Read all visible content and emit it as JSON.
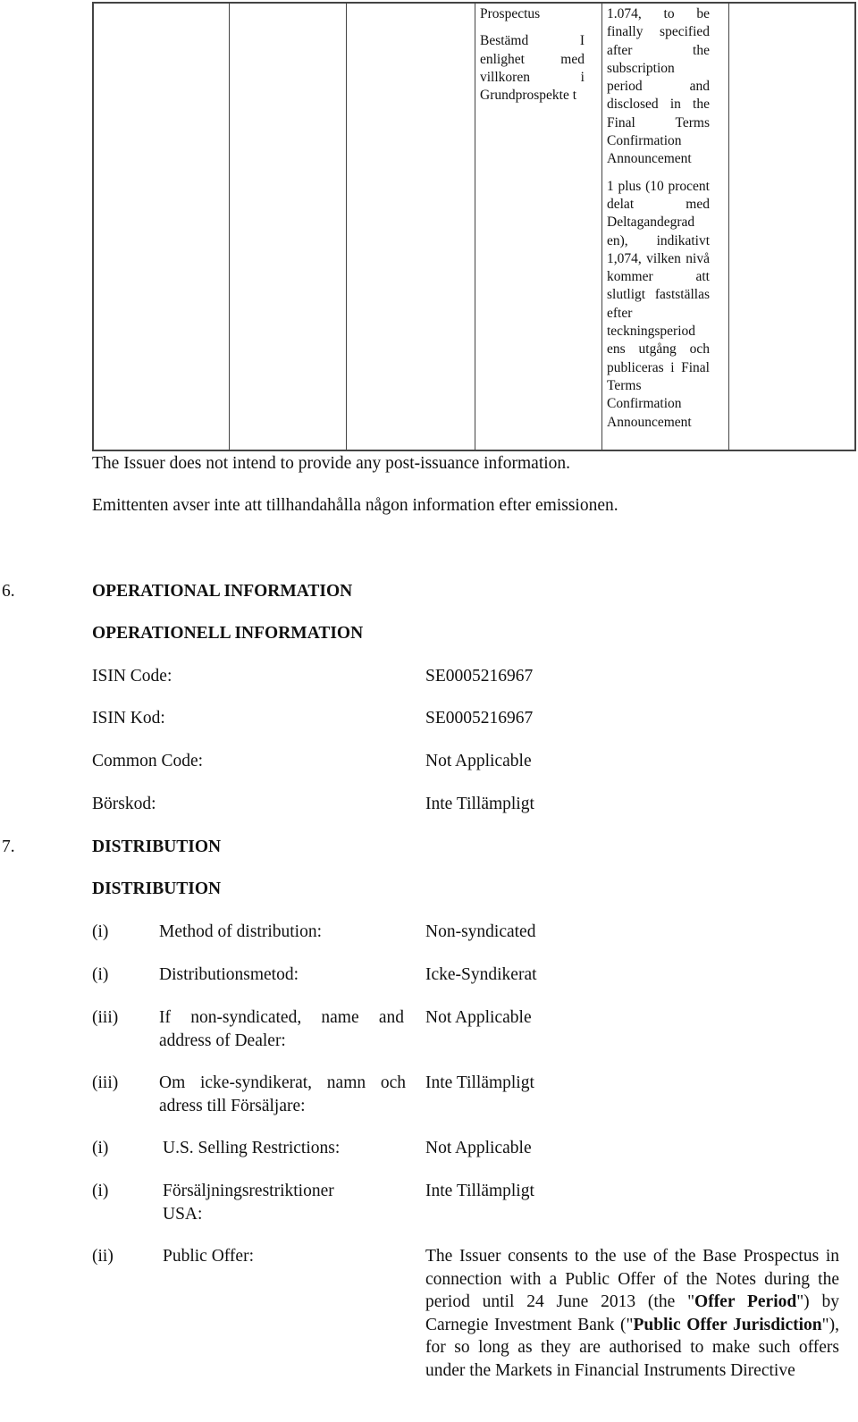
{
  "table": {
    "label_cell": {
      "en": "Prospectus",
      "sv": "Bestämd I enlighet med villkoren i Grundprospekte t"
    },
    "value_cell": {
      "en": "1.074, to be finally specified after the subscription period and disclosed in the Final Terms Confirmation Announcement",
      "sv": "1 plus (10 procent delat med Deltagandegrad en), indikativt 1,074, vilken nivå kommer att slutligt fastställas efter teckningsperiod ens utgång och publiceras i Final Terms Confirmation Announcement"
    }
  },
  "post_issuance": {
    "en": "The Issuer does not intend to provide any post-issuance information.",
    "sv": "Emittenten avser inte att tillhandahålla någon information efter emissionen."
  },
  "section6": {
    "number": "6.",
    "title_en": "OPERATIONAL INFORMATION",
    "title_sv": "OPERATIONELL INFORMATION",
    "rows": [
      {
        "label": "ISIN Code:",
        "value": "SE0005216967"
      },
      {
        "label": "ISIN Kod:",
        "value": "SE0005216967"
      },
      {
        "label": "Common Code:",
        "value": "Not Applicable"
      },
      {
        "label": "Börskod:",
        "value": "Inte Tillämpligt"
      }
    ]
  },
  "section7": {
    "number": "7.",
    "title_en": "DISTRIBUTION",
    "title_sv": "DISTRIBUTION",
    "rows": [
      {
        "enum": "(i)",
        "label": "Method of distribution:",
        "value": "Non-syndicated"
      },
      {
        "enum": "(i)",
        "label": "Distributionsmetod:",
        "value": "Icke-Syndikerat"
      },
      {
        "enum": "(iii)",
        "label": "If non-syndicated, name and address of Dealer:",
        "value": "Not Applicable"
      },
      {
        "enum": "(iii)",
        "label": "Om icke-syndikerat, namn och adress till Försäljare:",
        "value": "Inte Tillämpligt"
      },
      {
        "enum": "(i)",
        "label": "U.S. Selling Restrictions:",
        "value": "Not Applicable"
      },
      {
        "enum": "(i)",
        "label": "Försäljningsrestriktioner USA:",
        "value": "Inte Tillämpligt"
      }
    ],
    "public_offer": {
      "enum": "(ii)",
      "label": "Public Offer:",
      "value_parts": [
        "The Issuer consents to the use of the Base Prospectus in connection with a Public Offer of the Notes during the period until 24 June 2013 (the \"",
        "Offer Period",
        "\") by Carnegie Investment Bank (\"",
        "Public Offer Jurisdiction",
        "\"), for so long as they are authorised to make such offers under the Markets in Financial Instruments Directive"
      ]
    }
  }
}
